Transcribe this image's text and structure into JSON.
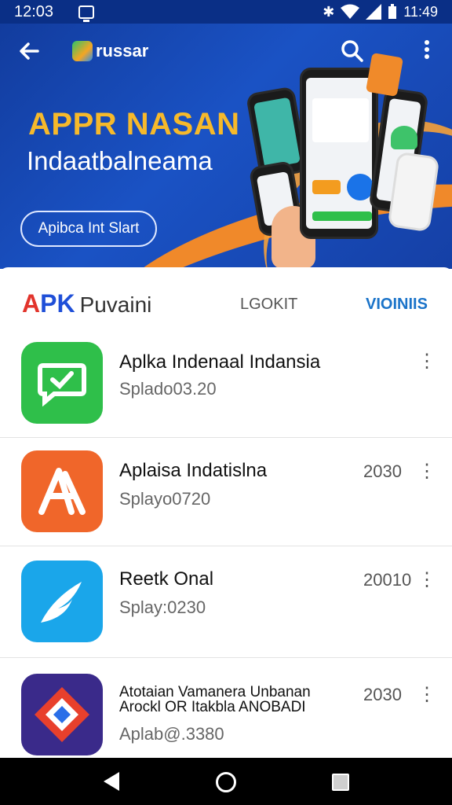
{
  "status_bar": {
    "time_left": "12:03",
    "time_right": "11:49"
  },
  "banner": {
    "logo_text": "russar",
    "headline": "APPR NASAN",
    "subline": "Indaatbalneama",
    "cta_label": "Apibca Int Slart",
    "colors": {
      "background": "#1a52c4",
      "accent": "#f0892a",
      "headline": "#f6b92b"
    }
  },
  "list_header": {
    "brand_apk": "APK",
    "brand_rest": "Puvaini",
    "tab_lookit": "LGOKIT",
    "tab_versions": "VIOINIIS"
  },
  "apps": [
    {
      "name": "Aplka Indenaal Indansia",
      "sub": "Splado03.20",
      "year": "",
      "icon": "chat-check-icon",
      "color": "#2fbf4a"
    },
    {
      "name": "Aplaisa Indatislna",
      "sub": "Splayo0720",
      "year": "2030",
      "icon": "letter-a-icon",
      "color": "#f0662a"
    },
    {
      "name": "Reetk Onal",
      "sub": "Splay:0230",
      "year": "20010",
      "icon": "feather-icon",
      "color": "#1aa6ea"
    },
    {
      "name": "Atotaian Vamanera Unbanan",
      "name2": "Arockl OR Itakbla ANOBADI",
      "sub": "Aplab@.3380",
      "year": "2030",
      "icon": "diamond-icon",
      "color": "#3a2a8a"
    }
  ],
  "nav": {
    "back": "back-icon",
    "home": "home-icon",
    "recents": "recents-icon"
  }
}
